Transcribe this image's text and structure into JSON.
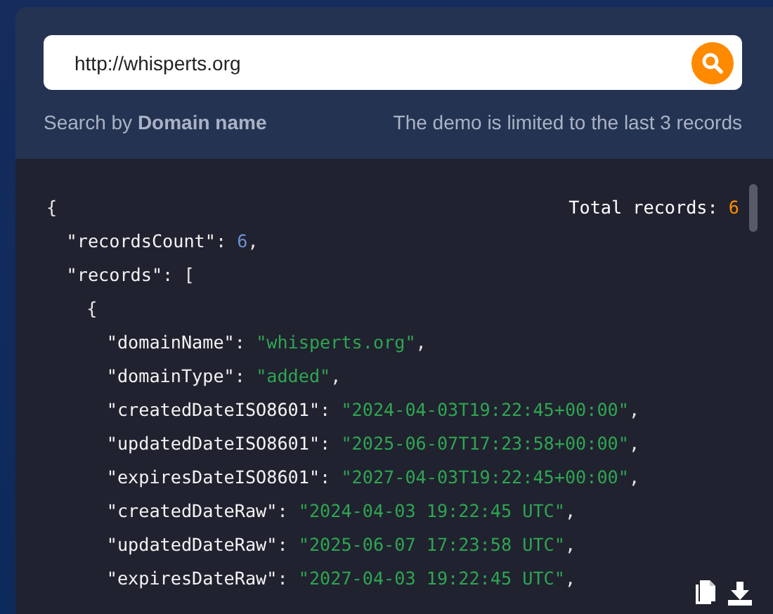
{
  "search": {
    "value": "http://whisperts.org"
  },
  "hint": "Search by **Domain name**",
  "notice": "The demo is limited to the last 3 records",
  "total_records": {
    "label": "Total records:",
    "value": "6"
  },
  "code": [
    {
      "tokens": [
        {
          "text": "{",
          "kind": "punct"
        }
      ],
      "children": [
        {
          "tokens": [
            {
              "text": "\"recordsCount\"",
              "kind": "key"
            },
            {
              "text": ": ",
              "kind": "punct"
            },
            {
              "text": "6",
              "kind": "number"
            },
            {
              "text": ",",
              "kind": "punct"
            }
          ]
        },
        {
          "tokens": [
            {
              "text": "\"records\"",
              "kind": "key"
            },
            {
              "text": ": [",
              "kind": "punct"
            }
          ],
          "children": [
            {
              "tokens": [
                {
                  "text": "{",
                  "kind": "punct"
                }
              ],
              "children": [
                {
                  "tokens": [
                    {
                      "text": "\"domainName\"",
                      "kind": "key"
                    },
                    {
                      "text": ": ",
                      "kind": "punct"
                    },
                    {
                      "text": "\"whisperts.org\"",
                      "kind": "string"
                    },
                    {
                      "text": ",",
                      "kind": "punct"
                    }
                  ]
                },
                {
                  "tokens": [
                    {
                      "text": "\"domainType\"",
                      "kind": "key"
                    },
                    {
                      "text": ": ",
                      "kind": "punct"
                    },
                    {
                      "text": "\"added\"",
                      "kind": "string"
                    },
                    {
                      "text": ",",
                      "kind": "punct"
                    }
                  ]
                },
                {
                  "tokens": [
                    {
                      "text": "\"createdDateISO8601\"",
                      "kind": "key"
                    },
                    {
                      "text": ": ",
                      "kind": "punct"
                    },
                    {
                      "text": "\"2024-04-03T19:22:45+00:00\"",
                      "kind": "string"
                    },
                    {
                      "text": ",",
                      "kind": "punct"
                    }
                  ]
                },
                {
                  "tokens": [
                    {
                      "text": "\"updatedDateISO8601\"",
                      "kind": "key"
                    },
                    {
                      "text": ": ",
                      "kind": "punct"
                    },
                    {
                      "text": "\"2025-06-07T17:23:58+00:00\"",
                      "kind": "string"
                    },
                    {
                      "text": ",",
                      "kind": "punct"
                    }
                  ]
                },
                {
                  "tokens": [
                    {
                      "text": "\"expiresDateISO8601\"",
                      "kind": "key"
                    },
                    {
                      "text": ": ",
                      "kind": "punct"
                    },
                    {
                      "text": "\"2027-04-03T19:22:45+00:00\"",
                      "kind": "string"
                    },
                    {
                      "text": ",",
                      "kind": "punct"
                    }
                  ]
                },
                {
                  "tokens": [
                    {
                      "text": "\"createdDateRaw\"",
                      "kind": "key"
                    },
                    {
                      "text": ": ",
                      "kind": "punct"
                    },
                    {
                      "text": "\"2024-04-03 19:22:45 UTC\"",
                      "kind": "string"
                    },
                    {
                      "text": ",",
                      "kind": "punct"
                    }
                  ]
                },
                {
                  "tokens": [
                    {
                      "text": "\"updatedDateRaw\"",
                      "kind": "key"
                    },
                    {
                      "text": ": ",
                      "kind": "punct"
                    },
                    {
                      "text": "\"2025-06-07 17:23:58 UTC\"",
                      "kind": "string"
                    },
                    {
                      "text": ",",
                      "kind": "punct"
                    }
                  ]
                },
                {
                  "tokens": [
                    {
                      "text": "\"expiresDateRaw\"",
                      "kind": "key"
                    },
                    {
                      "text": ": ",
                      "kind": "punct"
                    },
                    {
                      "text": "\"2027-04-03 19:22:45 UTC\"",
                      "kind": "string"
                    },
                    {
                      "text": ",",
                      "kind": "punct"
                    }
                  ]
                }
              ]
            }
          ]
        }
      ]
    }
  ]
}
